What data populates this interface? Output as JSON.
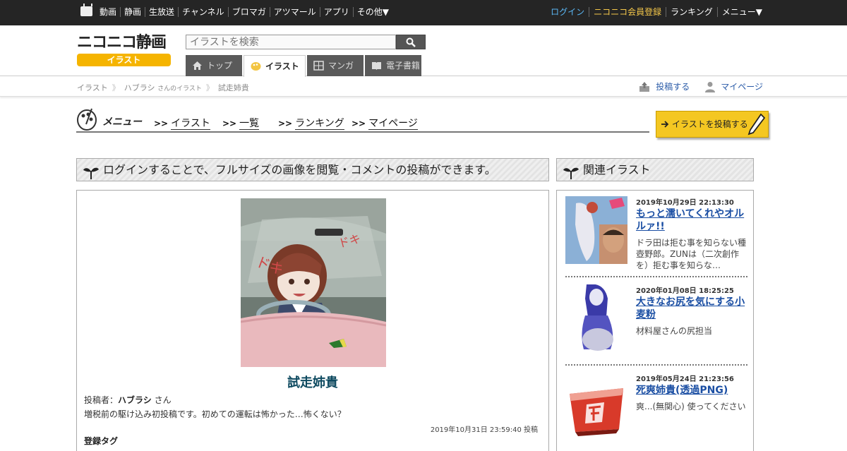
{
  "topnav": {
    "left": [
      "動画",
      "静画",
      "生放送",
      "チャンネル",
      "ブロマガ",
      "アツマール",
      "アプリ",
      "その他▼"
    ],
    "right": {
      "login": "ログイン",
      "register": "ニコニコ会員登録",
      "ranking": "ランキング",
      "menu": "メニュー▼"
    },
    "colors": {
      "login": "#5bb8f5",
      "register": "#f5c84a"
    }
  },
  "logo": {
    "main": "ニコニコ静画",
    "sub": "イラスト"
  },
  "search": {
    "placeholder": "イラストを検索"
  },
  "tabs": [
    {
      "label": "トップ",
      "icon": "home-icon"
    },
    {
      "label": "イラスト",
      "icon": "palette-icon"
    },
    {
      "label": "マンガ",
      "icon": "manga-icon"
    },
    {
      "label": "電子書籍",
      "icon": "book-icon"
    }
  ],
  "breadcrumb": {
    "root": "イラスト",
    "user": "ハブラシ",
    "user_suffix": "さんのイラスト",
    "current": "試走姉貴"
  },
  "actions": {
    "post": "投稿する",
    "mypage": "マイページ"
  },
  "menu": {
    "title": "メニュー",
    "links": [
      "イラスト",
      "一覧",
      "ランキング",
      "マイページ"
    ],
    "prefix": ">>",
    "post_button": "イラストを投稿する"
  },
  "login_notice": "ログインすることで、フルサイズの画像を閲覧・コメントの投稿ができます。",
  "related_title": "関連イラスト",
  "artwork": {
    "title": "試走姉貴",
    "poster_label": "投稿者：",
    "poster_name": "ハブラシ",
    "poster_suffix": "さん",
    "description": "増税前の駆け込み初投稿です。初めての運転は怖かった…怖くない？",
    "posted_at": "2019年10月31日 23:59:40 投稿",
    "tags_label": "登録タグ"
  },
  "related": [
    {
      "date": "2019年10月29日 22:13:30",
      "title": "もっと濡いてくれやオルルァ!!",
      "desc": "ドラ田は拒む事を知らない種壺野郎。ZUNは（二次創作を）拒む事を知らな…"
    },
    {
      "date": "2020年01月08日 18:25:25",
      "title": "大きなお尻を気にする小麦粉",
      "desc": "材料屋さんの尻担当"
    },
    {
      "date": "2019年05月24日 21:23:56",
      "title": "死爽姉貴(透過PNG)",
      "desc": "爽...(無関心) 使ってください"
    }
  ],
  "art_text": {
    "doki1": "ドキ",
    "doki2": "ドキ"
  }
}
